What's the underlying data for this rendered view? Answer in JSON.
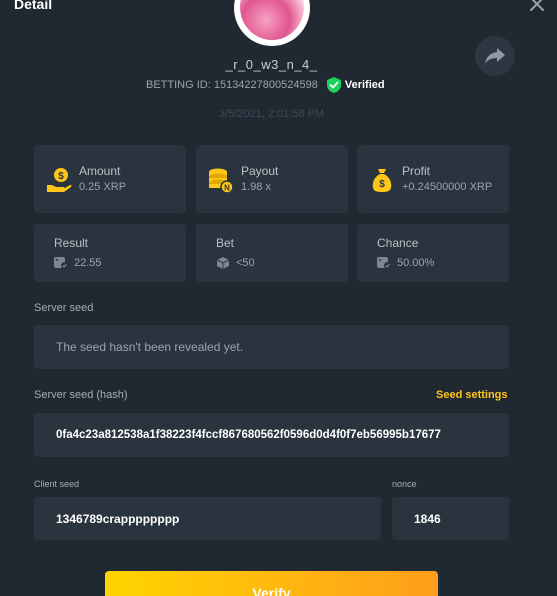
{
  "dialog": {
    "title": "Detail"
  },
  "player": {
    "username": "_r_0_w3_n_4_",
    "betting_id_label": "BETTING ID: 15134227800524598",
    "verified_label": "Verified",
    "date": "3/5/2021, 2:01:58 PM"
  },
  "stats": {
    "amount": {
      "label": "Amount",
      "value": "0.25 XRP"
    },
    "payout": {
      "label": "Payout",
      "value": "1.98 x"
    },
    "profit": {
      "label": "Profit",
      "value": "+0.24500000 XRP"
    },
    "result": {
      "label": "Result",
      "value": "22.55"
    },
    "bet": {
      "label": "Bet",
      "value": "<50"
    },
    "chance": {
      "label": "Chance",
      "value": "50.00%"
    }
  },
  "server_seed": {
    "label": "Server seed",
    "value": "The seed hasn't been revealed yet."
  },
  "server_seed_hash": {
    "label": "Server seed (hash)",
    "settings_link": "Seed settings",
    "value": "0fa4c23a812538a1f38223f4fccf867680562f0596d0d4f0f7eb56995b17677"
  },
  "client_seed": {
    "label": "Client seed",
    "value": "1346789crapppppppp"
  },
  "nonce": {
    "label": "nonce",
    "value": "1846"
  },
  "verify_button": {
    "label": "Verify"
  },
  "colors": {
    "background": "#202932",
    "card": "#2a343e",
    "accent": "#ffc61a",
    "verified": "#1bd35a"
  }
}
